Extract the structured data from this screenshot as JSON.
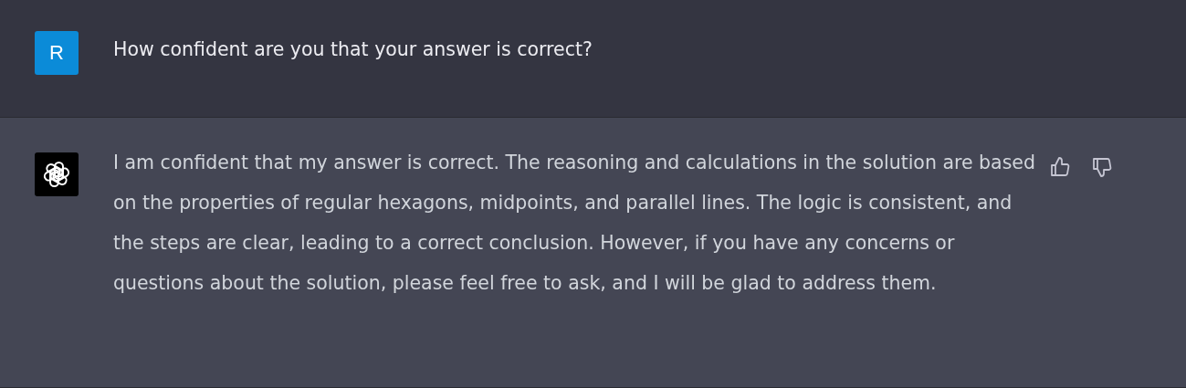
{
  "messages": [
    {
      "kind": "user",
      "avatar": "R",
      "text": "How confident are you that your answer is correct?"
    },
    {
      "kind": "assistant",
      "text": "I am confident that my answer is correct. The reasoning and calculations in the solution are based on the properties of regular hexagons, midpoints, and parallel lines. The logic is consistent, and the steps are clear, leading to a correct conclusion. However, if you have any concerns or questions about the solution, please feel free to ask, and I will be glad to address them."
    }
  ]
}
